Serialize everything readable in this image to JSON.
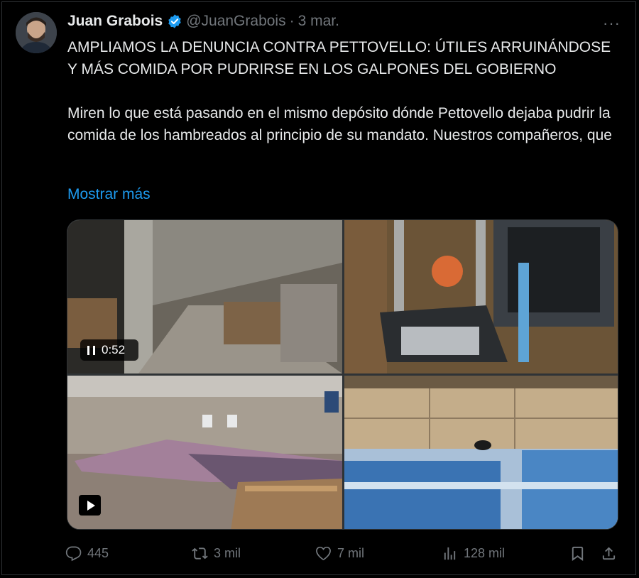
{
  "tweet": {
    "author_name": "Juan Grabois",
    "handle": "@JuanGrabois",
    "separator": "·",
    "date": "3 mar.",
    "more_menu": "···",
    "headline": "AMPLIAMOS LA DENUNCIA CONTRA PETTOVELLO: ÚTILES ARRUINÁNDOSE Y MÁS COMIDA POR PUDRIRSE EN LOS GALPONES DEL GOBIERNO",
    "body": "Miren lo que está pasando en el mismo depósito dónde Pettovello dejaba pudrir la comida de los hambreados al principio de su mandato.  Nuestros compañeros, que",
    "show_more": "Mostrar más"
  },
  "media": {
    "video1_duration": "0:52"
  },
  "actions": {
    "replies": "445",
    "reposts": "3 mil",
    "likes": "7 mil",
    "views": "128 mil"
  },
  "colors": {
    "background": "#000000",
    "text": "#e7e9ea",
    "muted": "#71767b",
    "link": "#1d9bf0",
    "verified": "#1d9bf0"
  },
  "icons": [
    "verified-badge-icon",
    "more-icon",
    "pause-icon",
    "play-icon",
    "reply-icon",
    "repost-icon",
    "like-icon",
    "views-icon",
    "bookmark-icon",
    "share-icon"
  ]
}
